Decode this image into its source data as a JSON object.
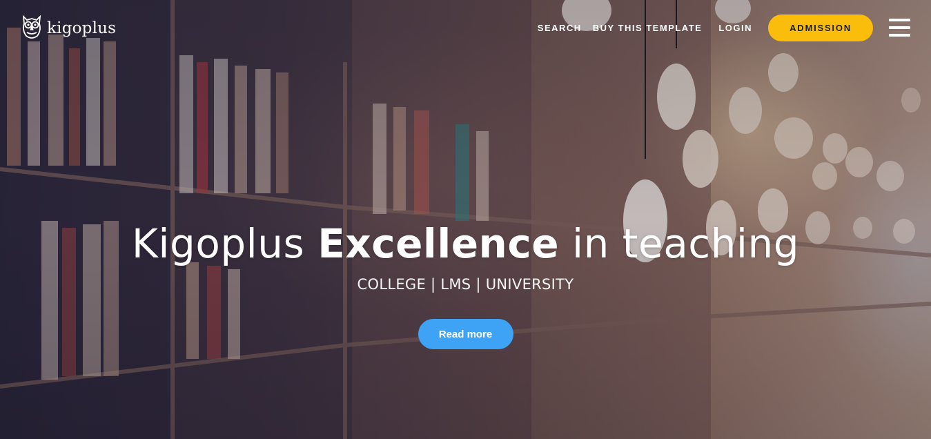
{
  "brand": {
    "name": "kigoplus",
    "logo_icon": "owl-icon"
  },
  "nav": {
    "search_label": "SEARCH",
    "buy_label": "BUY THIS TEMPLATE",
    "login_label": "LOGIN",
    "admission_label": "ADMISSION",
    "menu_icon": "hamburger-menu-icon"
  },
  "hero": {
    "headline_prefix": "Kigoplus ",
    "headline_strong": "Excellence",
    "headline_suffix": " in teaching",
    "subline": "COLLEGE | LMS | UNIVERSITY",
    "cta_label": "Read more"
  },
  "colors": {
    "admission_button": "#fbbd0b",
    "cta_button": "#3fa3f5",
    "text": "#ffffff"
  }
}
